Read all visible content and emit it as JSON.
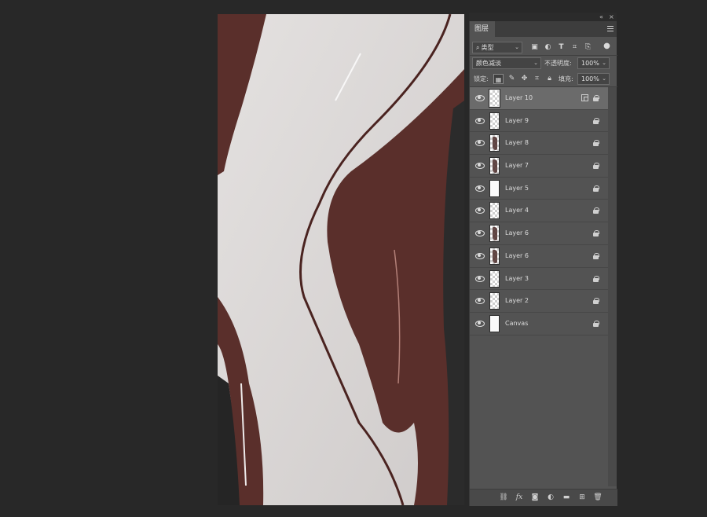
{
  "panel": {
    "topbar": {
      "collapse_glyph": "«",
      "close_glyph": "×"
    },
    "tab_label": "图层",
    "filter": {
      "icon": "search-icon",
      "value": "类型"
    },
    "blend_mode": "颜色减淡",
    "opacity_label": "不透明度:",
    "opacity_value": "100%",
    "lock_label": "锁定:",
    "fill_label": "填充:",
    "fill_value": "100%",
    "colors": {
      "panel_bg": "#535353",
      "active_row": "#6b6b6b",
      "canvas_brown": "#5a2f2b",
      "canvas_white": "#dcd8d7"
    }
  },
  "layers": [
    {
      "name": "Layer 10",
      "active": true,
      "thumb": "transparent",
      "linked": true
    },
    {
      "name": "Layer 9",
      "active": false,
      "thumb": "transparent"
    },
    {
      "name": "Layer 8",
      "active": false,
      "thumb": "stroke"
    },
    {
      "name": "Layer 7",
      "active": false,
      "thumb": "stroke"
    },
    {
      "name": "Layer 5",
      "active": false,
      "thumb": "white"
    },
    {
      "name": "Layer 4",
      "active": false,
      "thumb": "transparent"
    },
    {
      "name": "Layer 6",
      "active": false,
      "thumb": "stroke"
    },
    {
      "name": "Layer 6",
      "active": false,
      "thumb": "stroke"
    },
    {
      "name": "Layer 3",
      "active": false,
      "thumb": "transparent"
    },
    {
      "name": "Layer 2",
      "active": false,
      "thumb": "transparent"
    },
    {
      "name": "Canvas",
      "active": false,
      "thumb": "white"
    }
  ],
  "footer_icons": [
    "link-icon",
    "fx-icon",
    "mask-icon",
    "adjustment-icon",
    "folder-icon",
    "new-layer-icon",
    "trash-icon"
  ],
  "footer_glyphs": {
    "fx": "fx"
  }
}
